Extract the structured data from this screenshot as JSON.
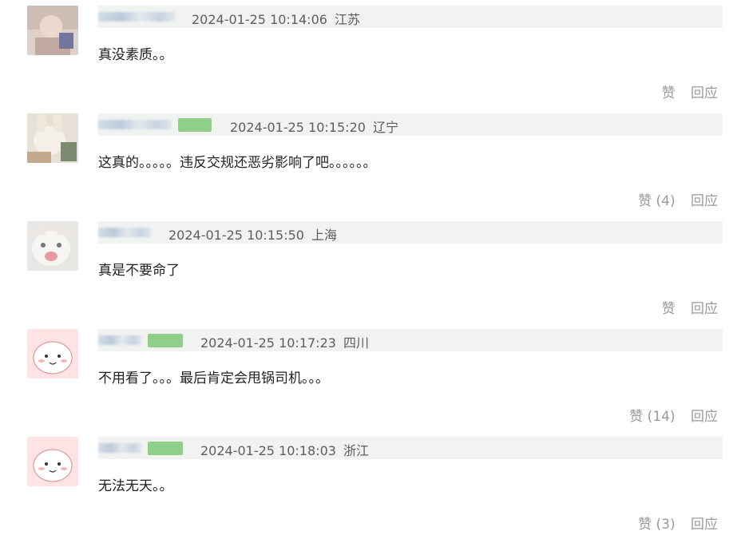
{
  "comments": [
    {
      "badge": "",
      "time": "2024-01-25 10:14:06",
      "location": "江苏",
      "text": "真没素质。。",
      "like": "赞",
      "reply": "回应"
    },
    {
      "badge": "",
      "time": "2024-01-25 10:15:20",
      "location": "辽宁",
      "text": "这真的。。。。。违反交规还恶劣影响了吧。。。。。。",
      "like": "赞 (4)",
      "reply": "回应"
    },
    {
      "badge": "",
      "time": "2024-01-25 10:15:50",
      "location": "上海",
      "text": "真是不要命了",
      "like": "赞",
      "reply": "回应"
    },
    {
      "badge": "",
      "time": "2024-01-25 10:17:23",
      "location": "四川",
      "text": "不用看了。。。最后肯定会甩锅司机。。。",
      "like": "赞 (14)",
      "reply": "回应"
    },
    {
      "badge": "",
      "time": "2024-01-25 10:18:03",
      "location": "浙江",
      "text": "无法无天。。",
      "like": "赞 (3)",
      "reply": "回应"
    }
  ],
  "colors": {
    "header_bg": "#f1f3f1",
    "badge_green": "#8fcf8a",
    "meta_text": "#5d5d5d",
    "action_text": "#9a9a9a"
  }
}
